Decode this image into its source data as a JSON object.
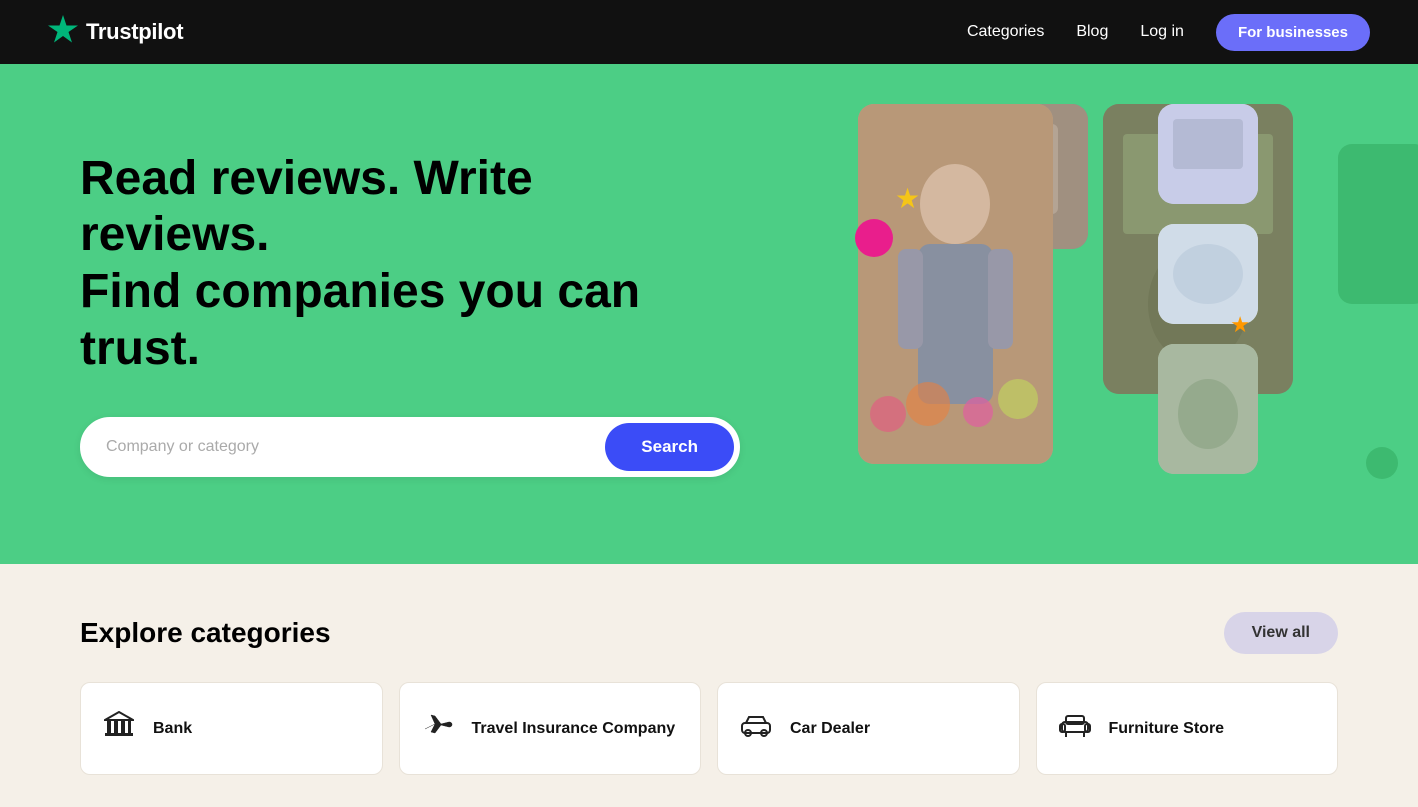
{
  "navbar": {
    "logo_text": "Trustpilot",
    "nav_items": [
      {
        "label": "Categories",
        "id": "nav-categories"
      },
      {
        "label": "Blog",
        "id": "nav-blog"
      },
      {
        "label": "Log in",
        "id": "nav-login"
      }
    ],
    "cta_button": "For businesses"
  },
  "hero": {
    "title_line1": "Read reviews. Write reviews.",
    "title_line2": "Find companies you can trust.",
    "search_placeholder": "Company or category",
    "search_button_label": "Search"
  },
  "categories": {
    "section_title": "Explore categories",
    "view_all_label": "View all",
    "items": [
      {
        "id": "bank",
        "label": "Bank",
        "icon": "bank"
      },
      {
        "id": "travel-insurance",
        "label": "Travel Insurance Company",
        "icon": "plane"
      },
      {
        "id": "car-dealer",
        "label": "Car Dealer",
        "icon": "car"
      },
      {
        "id": "furniture-store",
        "label": "Furniture Store",
        "icon": "furniture"
      }
    ]
  }
}
